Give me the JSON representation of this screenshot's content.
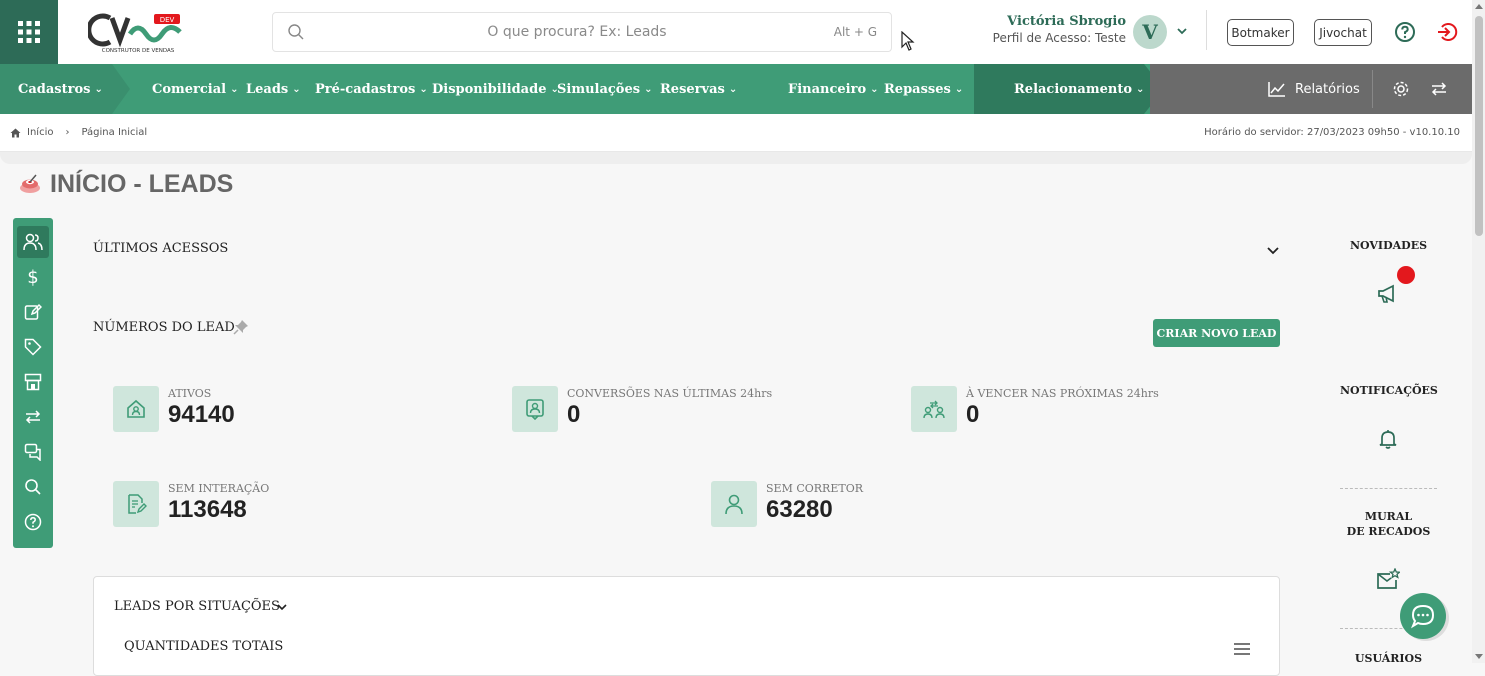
{
  "colors": {
    "brand": "#3f9c77",
    "brand_dark": "#2d6b57",
    "alert": "#e3181d"
  },
  "logo": {
    "text": "CV",
    "badge": "DEV",
    "tagline": "CONSTRUTOR DE VENDAS"
  },
  "search": {
    "placeholder": "O que procura? Ex: Leads",
    "shortcut": "Alt + G"
  },
  "user": {
    "name": "Victória Sbrogio",
    "profile": "Perfil de Acesso: Teste",
    "initial": "V"
  },
  "header_buttons": {
    "botmaker": "Botmaker",
    "jivochat": "Jivochat"
  },
  "nav": {
    "items": [
      {
        "label": "Cadastros"
      },
      {
        "label": "Comercial"
      },
      {
        "label": "Leads"
      },
      {
        "label": "Pré-cadastros"
      },
      {
        "label": "Disponibilidade"
      },
      {
        "label": "Simulações"
      },
      {
        "label": "Reservas"
      },
      {
        "label": "Financeiro"
      },
      {
        "label": "Repasses"
      },
      {
        "label": "Relacionamento"
      }
    ],
    "reports": "Relatórios"
  },
  "breadcrumb": {
    "home": "Início",
    "current": "Página Inicial"
  },
  "server_time": "Horário do servidor: 27/03/2023 09h50 - v10.10.10",
  "page_title": "INÍCIO - LEADS",
  "sections": {
    "last_access": "ÚLTIMOS ACESSOS",
    "lead_numbers": "NÚMEROS DO LEAD",
    "create_lead": "CRIAR NOVO LEAD",
    "by_status": "LEADS POR SITUAÇÕES",
    "totals": "QUANTIDADES TOTAIS"
  },
  "stats": [
    {
      "label": "ATIVOS",
      "value": "94140",
      "icon": "house-icon"
    },
    {
      "label": "CONVERSÕES NAS ÚLTIMAS 24hrs",
      "value": "0",
      "icon": "user-badge-icon"
    },
    {
      "label": "À VENCER NAS PRÓXIMAS 24hrs",
      "value": "0",
      "icon": "users-swap-icon"
    },
    {
      "label": "SEM INTERAÇÃO",
      "value": "113648",
      "icon": "document-edit-icon"
    },
    {
      "label": "SEM CORRETOR",
      "value": "63280",
      "icon": "user-icon"
    }
  ],
  "right_panel": {
    "news": "NOVIDADES",
    "notifications": "NOTIFICAÇÕES",
    "wall_line1": "MURAL",
    "wall_line2": "DE RECADOS",
    "users": "USUÁRIOS"
  }
}
